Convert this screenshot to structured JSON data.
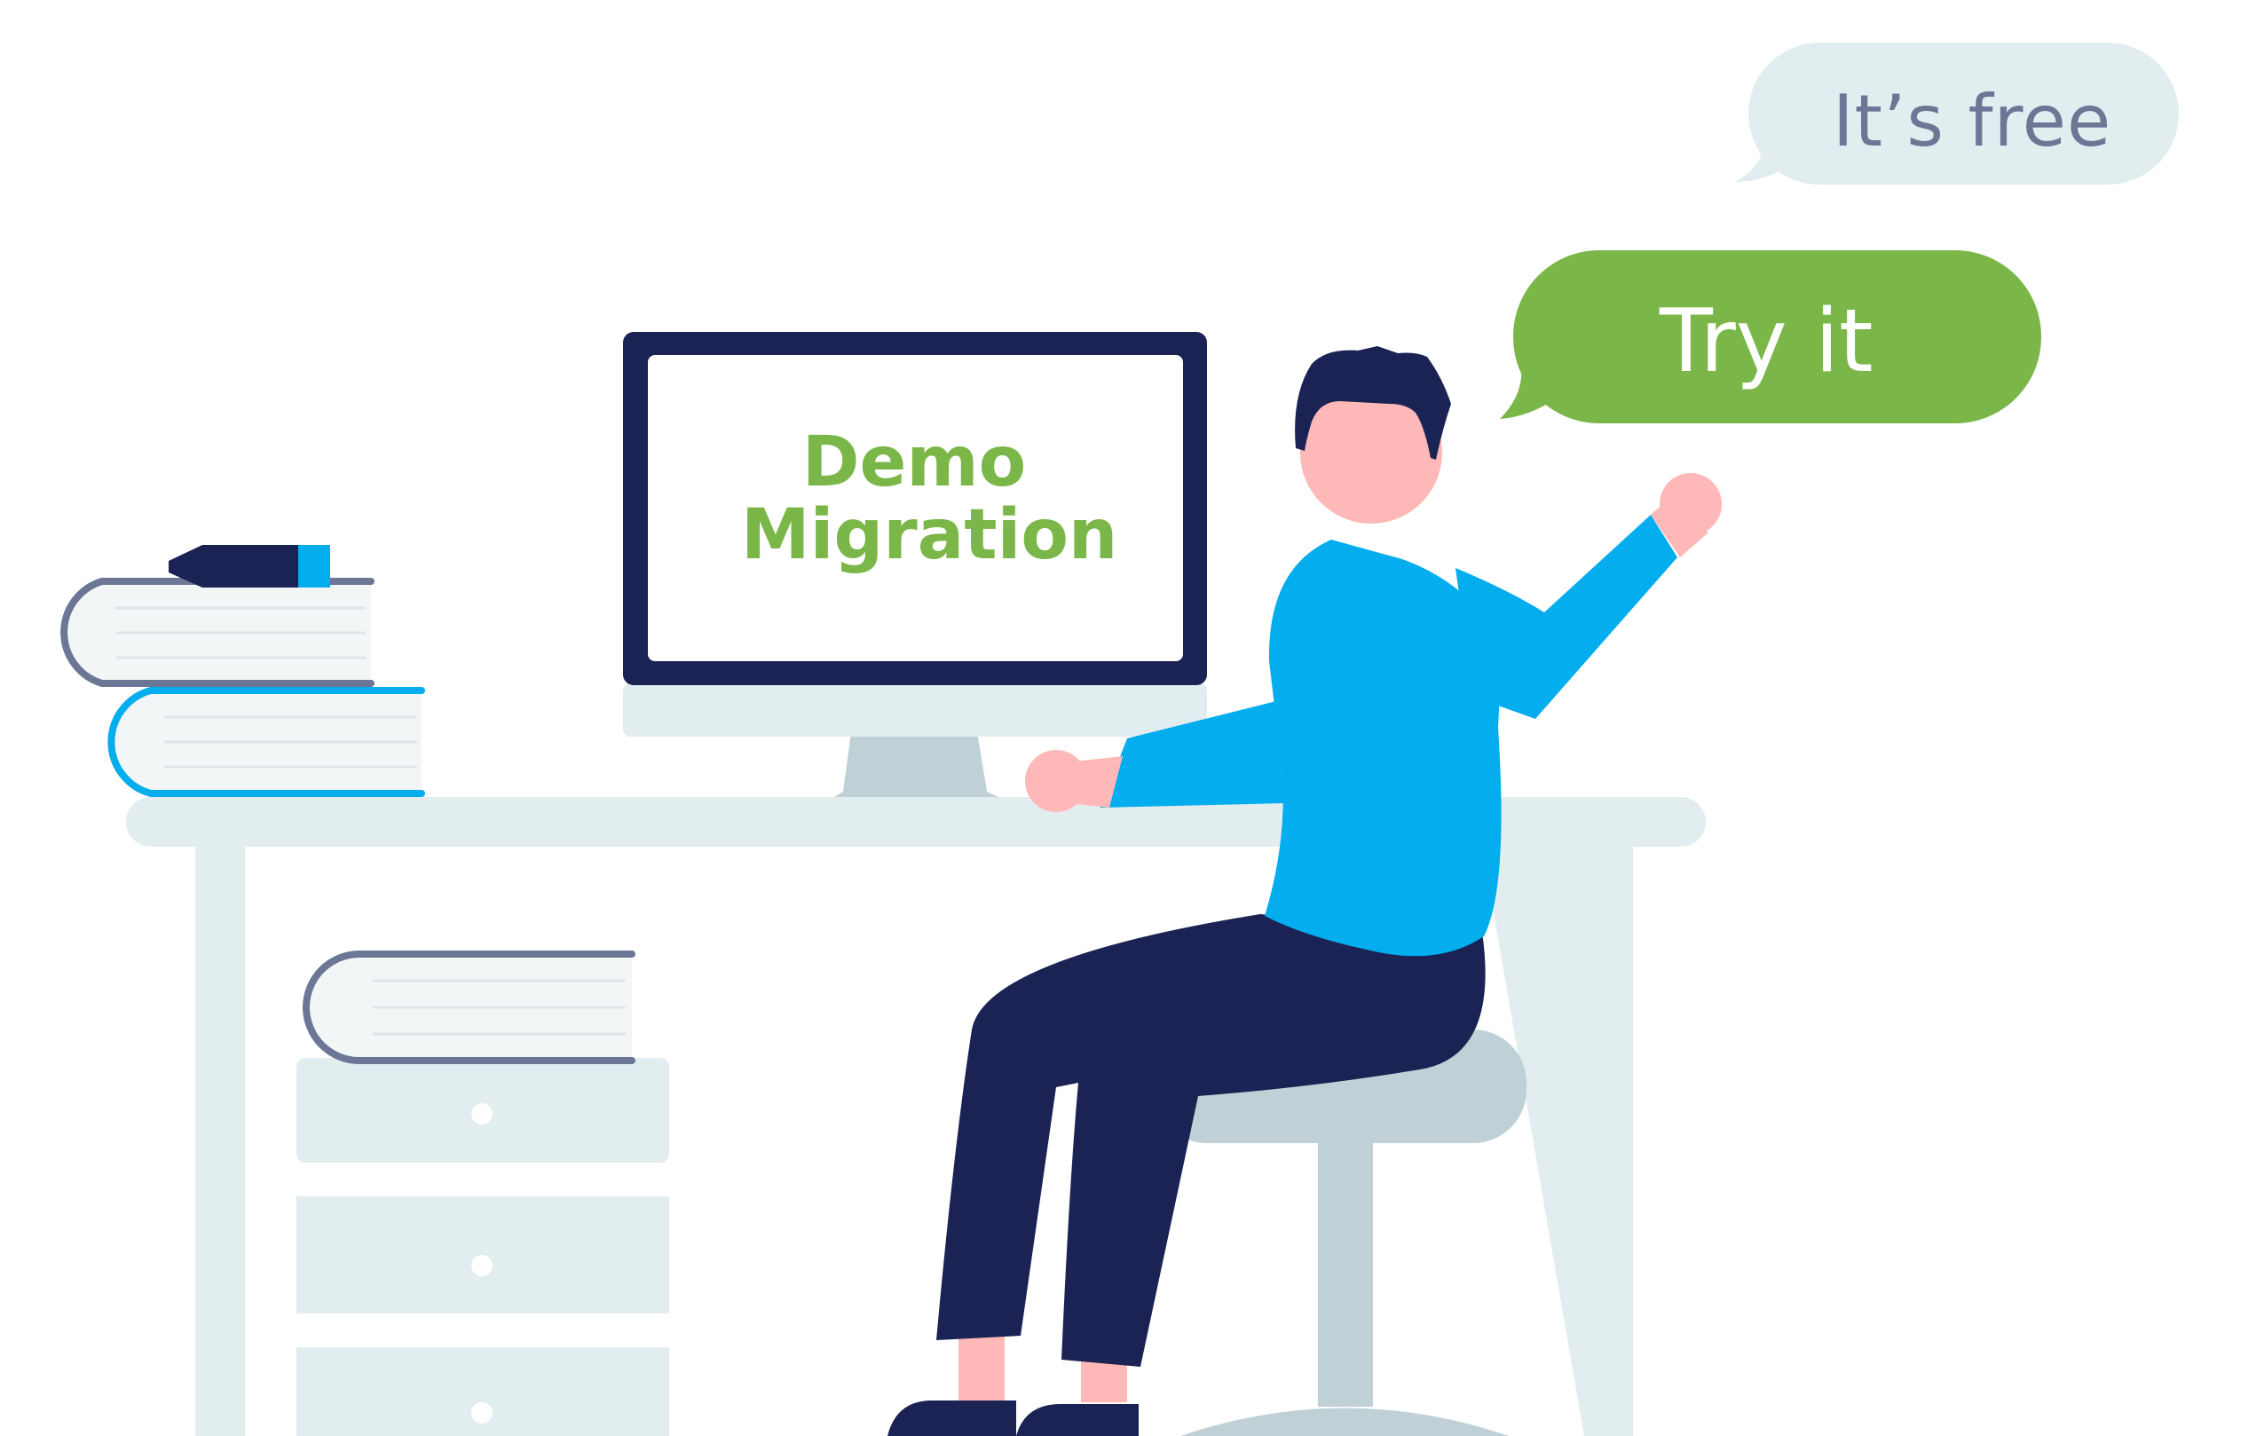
{
  "bubbles": {
    "free_label": "It’s free",
    "try_label": "Try it"
  },
  "monitor": {
    "line1": "Demo",
    "line2": "Migration"
  },
  "colors": {
    "green": "#7ab648",
    "blue": "#03adee",
    "navy": "#1b2254",
    "light": "#e2edf0",
    "grey": "#bfd1d6",
    "skin": "#feb8b8",
    "slate": "#6b7794"
  }
}
